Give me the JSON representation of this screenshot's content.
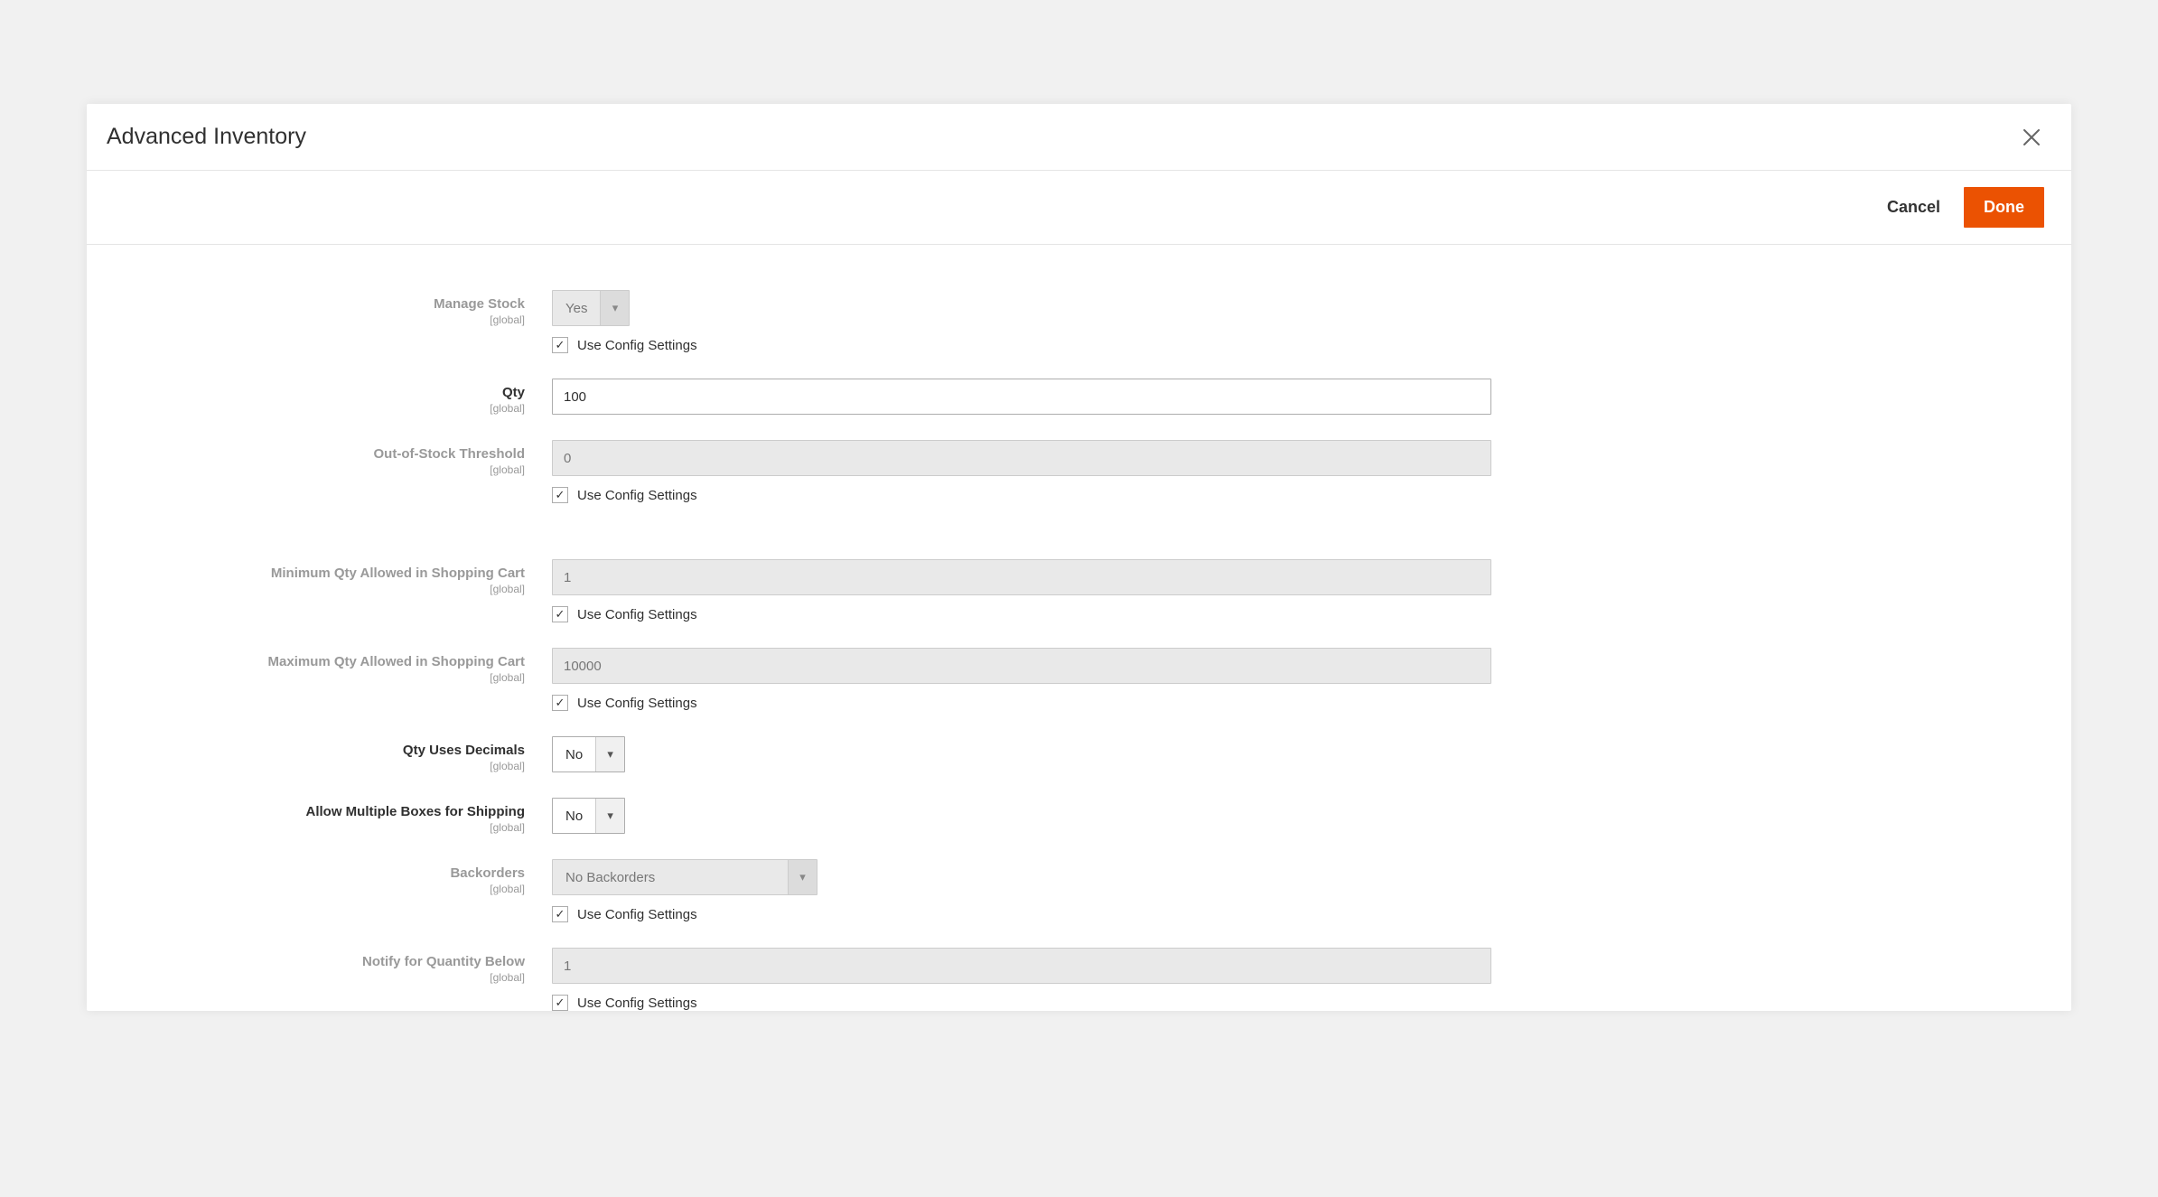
{
  "modal": {
    "title": "Advanced Inventory"
  },
  "actions": {
    "cancel": "Cancel",
    "done": "Done"
  },
  "common": {
    "scope": "[global]",
    "use_config": "Use Config Settings",
    "check_mark": "✓"
  },
  "fields": {
    "manage_stock": {
      "label": "Manage Stock",
      "value": "Yes",
      "use_config": true,
      "disabled": true
    },
    "qty": {
      "label": "Qty",
      "value": "100"
    },
    "out_of_stock": {
      "label": "Out-of-Stock Threshold",
      "value": "0",
      "use_config": true,
      "disabled": true
    },
    "min_qty": {
      "label": "Minimum Qty Allowed in Shopping Cart",
      "value": "1",
      "use_config": true,
      "disabled": true
    },
    "max_qty": {
      "label": "Maximum Qty Allowed in Shopping Cart",
      "value": "10000",
      "use_config": true,
      "disabled": true
    },
    "decimals": {
      "label": "Qty Uses Decimals",
      "value": "No"
    },
    "multi_boxes": {
      "label": "Allow Multiple Boxes for Shipping",
      "value": "No"
    },
    "backorders": {
      "label": "Backorders",
      "value": "No Backorders",
      "use_config": true,
      "disabled": true
    },
    "notify_below": {
      "label": "Notify for Quantity Below",
      "value": "1",
      "use_config": true,
      "disabled": true
    }
  }
}
